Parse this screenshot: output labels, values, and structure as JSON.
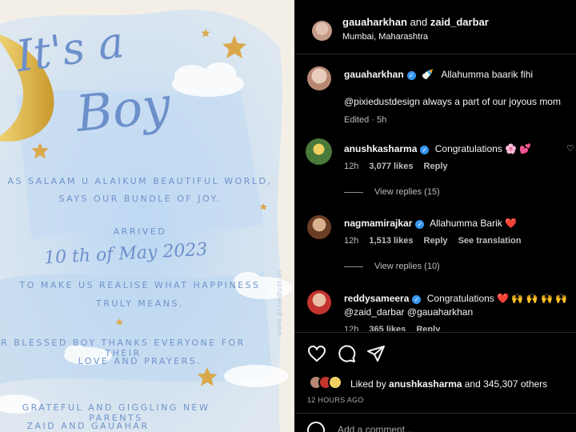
{
  "invitation": {
    "title_line1": "It's a",
    "title_line2": "Boy",
    "greeting_line1": "AS SALAAM U ALAIKUM BEAUTIFUL WORLD,",
    "greeting_line2": "SAYS OUR BUNDLE OF JOY.",
    "arrived": "ARRIVED",
    "date": "10 th of May 2023",
    "line3": "TO MAKE US REALISE WHAT HAPPINESS",
    "line4": "TRULY MEANS.",
    "line5": "R BLESSED BOY THANKS EVERYONE FOR THEIR",
    "line6": "LOVE AND PRAYERS.",
    "line7": "GRATEFUL AND GIGGLING NEW PARENTS",
    "line8": "ZAID AND GAUAHAR",
    "watermark": "www.pixiedust.in"
  },
  "header": {
    "user1": "gauaharkhan",
    "and": " and ",
    "user2": "zaid_darbar",
    "location": "Mumbai, Maharashtra"
  },
  "caption": {
    "username": "gauaharkhan",
    "text": "Allahumma baarik fihi",
    "text2": "@pixiedustdesign always a part of our joyous mom",
    "meta": "Edited · 5h"
  },
  "comments": [
    {
      "username": "anushkasharma",
      "text": "Congratulations 🌸 💕",
      "time": "12h",
      "likes": "3,077 likes",
      "reply": "Reply",
      "view_replies": "View replies (15)"
    },
    {
      "username": "nagmamirajkar",
      "text": "Allahumma Barik ❤️",
      "time": "12h",
      "likes": "1,513 likes",
      "reply": "Reply",
      "translate": "See translation",
      "view_replies": "View replies (10)"
    },
    {
      "username": "reddysameera",
      "text": "Congratulations ❤️ 🙌 🙌 🙌 🙌",
      "text2": "@zaid_darbar @gauaharkhan",
      "time": "12h",
      "likes": "365 likes",
      "reply": "Reply"
    }
  ],
  "likes": {
    "prefix": "Liked by ",
    "user": "anushkasharma",
    "suffix": " and 345,307 others"
  },
  "timestamp": "12 HOURS AGO",
  "add_comment_placeholder": "Add a comment...",
  "colors": {
    "accent": "#3897f0",
    "heart": "#ed4956",
    "invite_blue": "#6f93c9",
    "star_gold": "#d9a84a"
  }
}
